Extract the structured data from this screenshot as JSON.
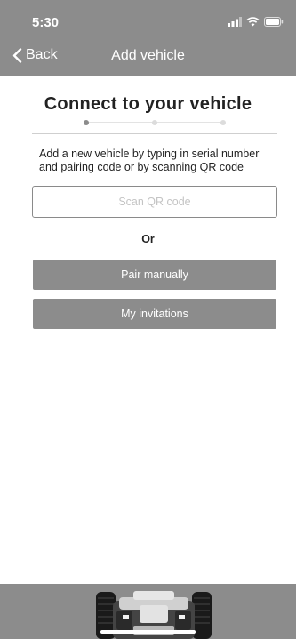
{
  "status_bar": {
    "time": "5:30",
    "icons": [
      "signal-icon",
      "wifi-icon",
      "battery-icon"
    ]
  },
  "nav": {
    "back_label": "Back",
    "title": "Add vehicle"
  },
  "main": {
    "title": "Connect to your vehicle",
    "stepper": {
      "steps": 3,
      "current": 1
    },
    "description": "Add a new vehicle by typing in serial number and pairing code or by scanning QR code",
    "scan_button": "Scan QR code",
    "or_label": "Or",
    "pair_button": "Pair manually",
    "invitations_button": "My invitations"
  },
  "colors": {
    "bar": "#8c8c8c",
    "button": "#8c8c8c",
    "active_dot": "#8c8c8c",
    "inactive_dot": "#dcdcdc"
  }
}
